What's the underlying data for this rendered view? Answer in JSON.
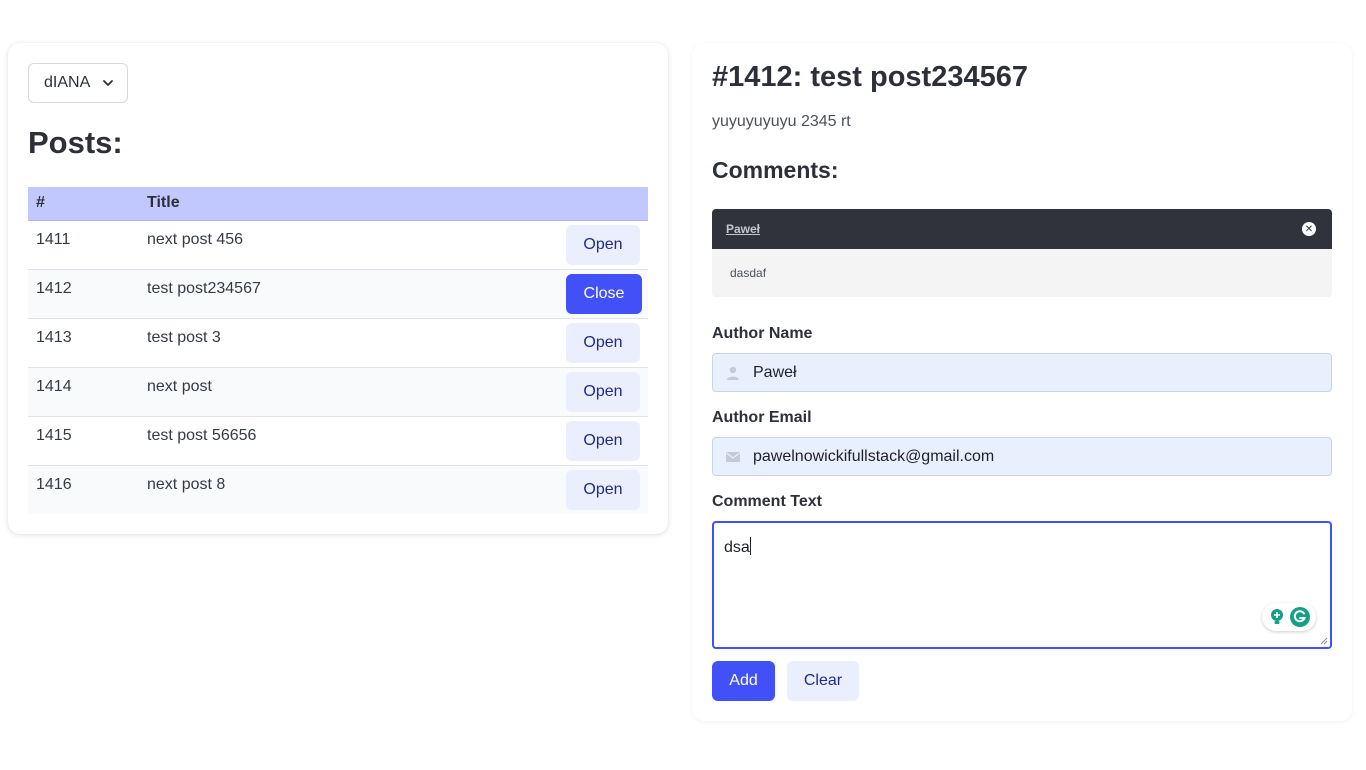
{
  "user_select": {
    "value": "dIANA",
    "icon": "chevron-down-icon"
  },
  "posts": {
    "title": "Posts:",
    "columns": [
      "#",
      "Title",
      ""
    ],
    "rows": [
      {
        "id": "1411",
        "title": "next post 456",
        "action": "Open"
      },
      {
        "id": "1412",
        "title": "test post234567",
        "action": "Close"
      },
      {
        "id": "1413",
        "title": "test post 3",
        "action": "Open"
      },
      {
        "id": "1414",
        "title": "next post",
        "action": "Open"
      },
      {
        "id": "1415",
        "title": "test post 56656",
        "action": "Open"
      },
      {
        "id": "1416",
        "title": "next post 8",
        "action": "Open"
      }
    ]
  },
  "detail": {
    "heading": "#1412: test post234567",
    "body": "yuyuyuyuyu 2345 rt",
    "comments_title": "Comments:",
    "comments": [
      {
        "author": "Paweł",
        "text": "dasdaf"
      }
    ]
  },
  "form": {
    "author_name_label": "Author Name",
    "author_name_value": "Paweł",
    "author_email_label": "Author Email",
    "author_email_value": "pawelnowickifullstack@gmail.com",
    "comment_text_label": "Comment Text",
    "comment_text_value": "dsa",
    "add_label": "Add",
    "clear_label": "Clear"
  },
  "colors": {
    "primary": "#4150f7",
    "header_row": "#c0c8fd",
    "secondary_button": "#ebeefd",
    "comment_header": "#30333b"
  }
}
